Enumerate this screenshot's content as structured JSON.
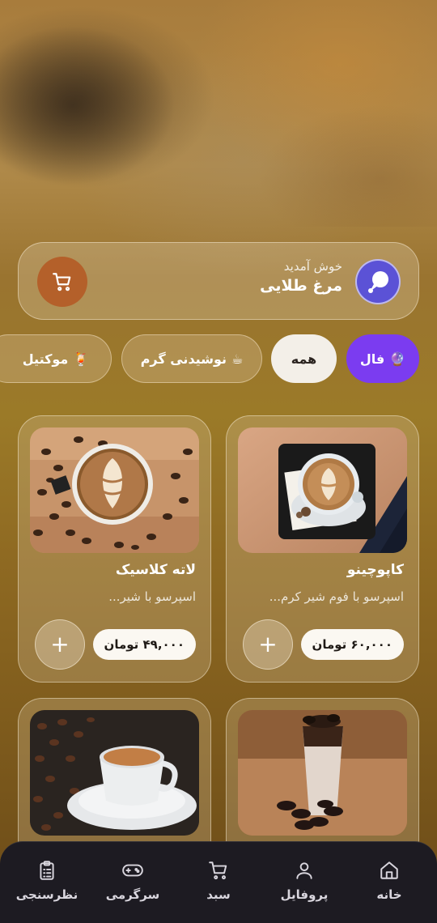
{
  "header": {
    "welcome_text": "خوش آمدید",
    "user_name": "مرغ طلایی",
    "avatar_icon": "chat-bubble-icon",
    "cart_icon": "cart-icon",
    "accent_color": "#b4602a"
  },
  "categories": [
    {
      "label": "فال",
      "emoji": "🔮",
      "active_color": "#7b3cf0"
    },
    {
      "label": "همه",
      "emoji": ""
    },
    {
      "label": "نوشیدنی گرم",
      "emoji": "☕"
    },
    {
      "label": "موکتیل",
      "emoji": "🍹"
    }
  ],
  "products": [
    {
      "title": "کاپوچینو",
      "desc": "اسپرسو با فوم شیر کرم...",
      "price": "۶۰,۰۰۰ تومان",
      "add_label": "+"
    },
    {
      "title": "لاته کلاسیک",
      "desc": "اسپرسو با شیر...",
      "price": "۴۹,۰۰۰ تومان",
      "add_label": "+"
    },
    {
      "title": "",
      "desc": "",
      "price": "",
      "add_label": ""
    },
    {
      "title": "",
      "desc": "",
      "price": "",
      "add_label": ""
    }
  ],
  "nav": [
    {
      "label": "خانه",
      "icon": "home-icon"
    },
    {
      "label": "پروفایل",
      "icon": "user-icon"
    },
    {
      "label": "سبد",
      "icon": "cart-icon"
    },
    {
      "label": "سرگرمی",
      "icon": "gamepad-icon"
    },
    {
      "label": "نظرسنجی",
      "icon": "clipboard-icon"
    }
  ]
}
